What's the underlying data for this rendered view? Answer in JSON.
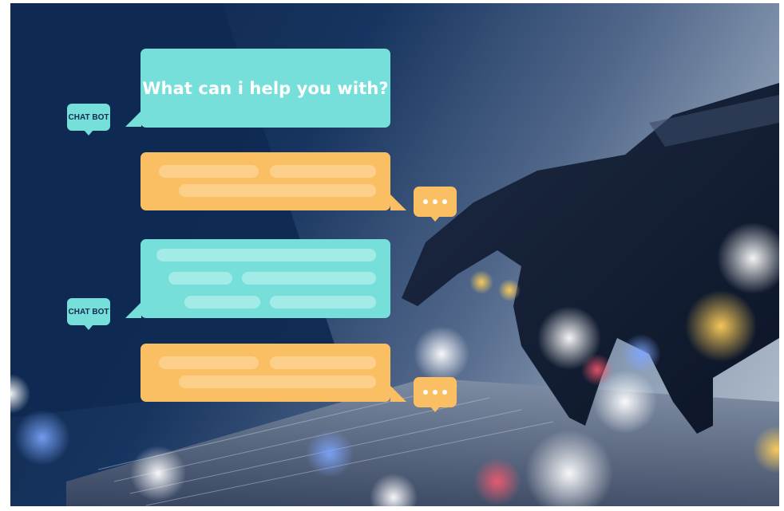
{
  "chat": {
    "question": "What can i help you with?",
    "bot_label": "CHAT BOT"
  },
  "colors": {
    "bot_bubble": "#77dfd9",
    "user_bubble": "#fbbf63",
    "navy": "#0e2649"
  },
  "icons": [
    "typing-indicator-icon",
    "robot-hand",
    "laptop-keyboard"
  ]
}
